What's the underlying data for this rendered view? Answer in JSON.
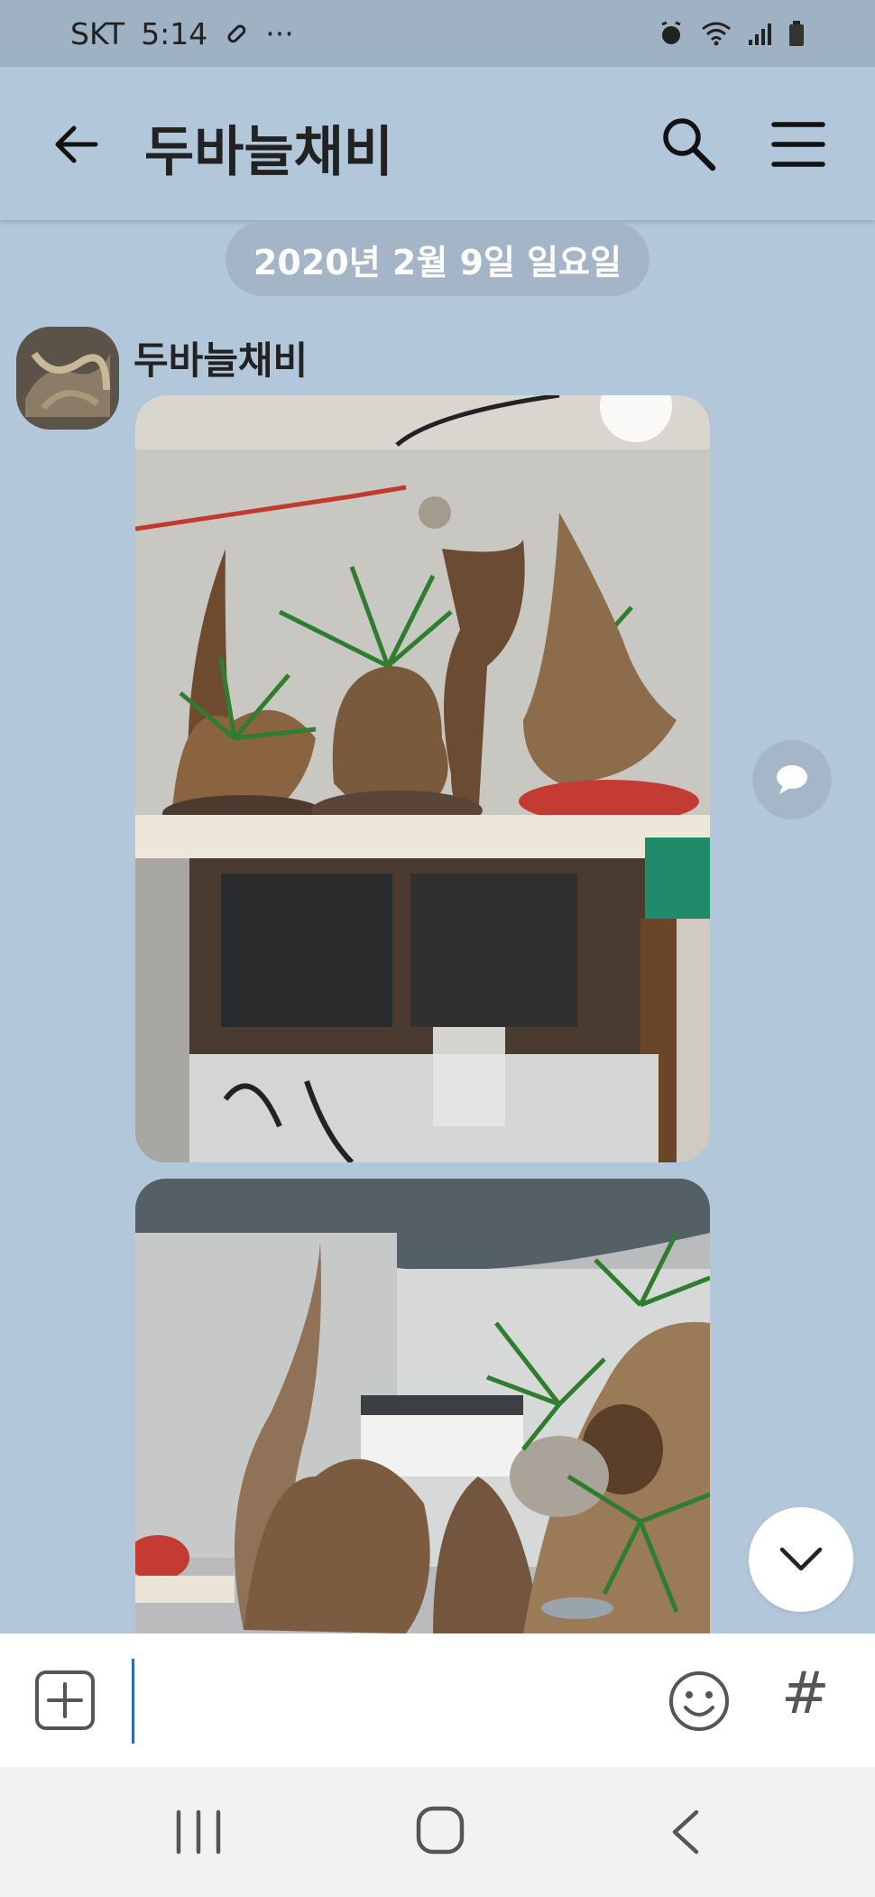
{
  "status": {
    "carrier": "SKT",
    "time": "5:14",
    "more": "···"
  },
  "header": {
    "title": "두바늘채비"
  },
  "date_divider": "2020년 2월 9일 일요일",
  "message": {
    "sender": "두바늘채비"
  },
  "input": {
    "value": ""
  },
  "hash_label": "#",
  "colors": {
    "background": "#b2c7d9",
    "status_bar": "#9fb2c4",
    "input_cursor": "#2d6cb5"
  },
  "icons": [
    "back-arrow-icon",
    "search-icon",
    "menu-icon",
    "share-icon",
    "chevron-down-icon",
    "plus-icon",
    "emoji-icon",
    "recent-apps-icon",
    "home-icon",
    "nav-back-icon"
  ]
}
